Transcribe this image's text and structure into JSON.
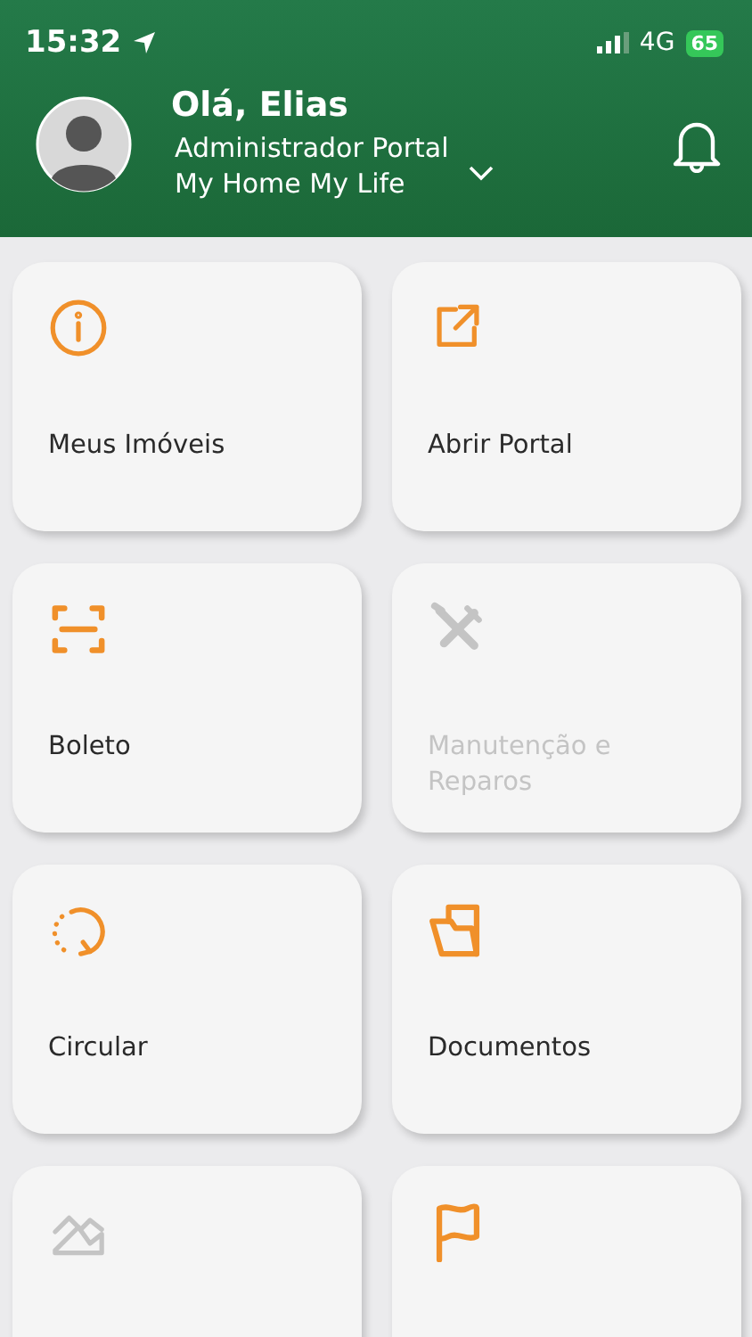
{
  "status_bar": {
    "time": "15:32",
    "network": "4G",
    "battery": "65"
  },
  "header": {
    "greeting": "Olá, Elias",
    "role": "Administrador Portal",
    "account": "My Home My Life"
  },
  "tiles": [
    {
      "kind": "info",
      "label": "Meus Imóveis",
      "disabled": false
    },
    {
      "kind": "external",
      "label": "Abrir Portal",
      "disabled": false
    },
    {
      "kind": "scan",
      "label": "Boleto",
      "disabled": false
    },
    {
      "kind": "tools",
      "label": "Manutenção e Reparos",
      "disabled": true
    },
    {
      "kind": "refresh",
      "label": "Circular",
      "disabled": false
    },
    {
      "kind": "folder",
      "label": "Documentos",
      "disabled": false
    },
    {
      "kind": "chart",
      "disabled": true
    },
    {
      "kind": "flag",
      "disabled": false
    }
  ]
}
